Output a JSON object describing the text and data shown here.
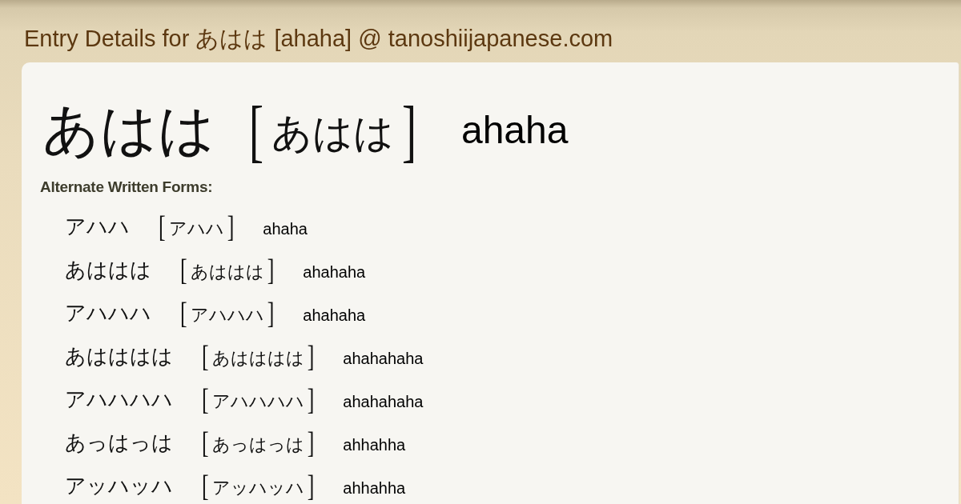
{
  "page_title": "Entry Details for あはは [ahaha] @ tanoshiijapanese.com",
  "entry": {
    "word": "あはは",
    "bracket_open": "[",
    "reading": "あはは",
    "bracket_close": "]",
    "romaji": "ahaha"
  },
  "alternate_forms": {
    "heading": "Alternate Written Forms:",
    "items": [
      {
        "word": "アハハ",
        "bracket_open": "[",
        "reading": "アハハ",
        "bracket_close": "]",
        "romaji": "ahaha"
      },
      {
        "word": "あははは",
        "bracket_open": "[",
        "reading": "あははは",
        "bracket_close": "]",
        "romaji": "ahahaha"
      },
      {
        "word": "アハハハ",
        "bracket_open": "[",
        "reading": "アハハハ",
        "bracket_close": "]",
        "romaji": "ahahaha"
      },
      {
        "word": "あはははは",
        "bracket_open": "[",
        "reading": "あはははは",
        "bracket_close": "]",
        "romaji": "ahahahaha"
      },
      {
        "word": "アハハハハ",
        "bracket_open": "[",
        "reading": "アハハハハ",
        "bracket_close": "]",
        "romaji": "ahahahaha"
      },
      {
        "word": "あっはっは",
        "bracket_open": "[",
        "reading": "あっはっは",
        "bracket_close": "]",
        "romaji": "ahhahha"
      },
      {
        "word": "アッハッハ",
        "bracket_open": "[",
        "reading": "アッハッハ",
        "bracket_close": "]",
        "romaji": "ahhahha"
      }
    ]
  }
}
